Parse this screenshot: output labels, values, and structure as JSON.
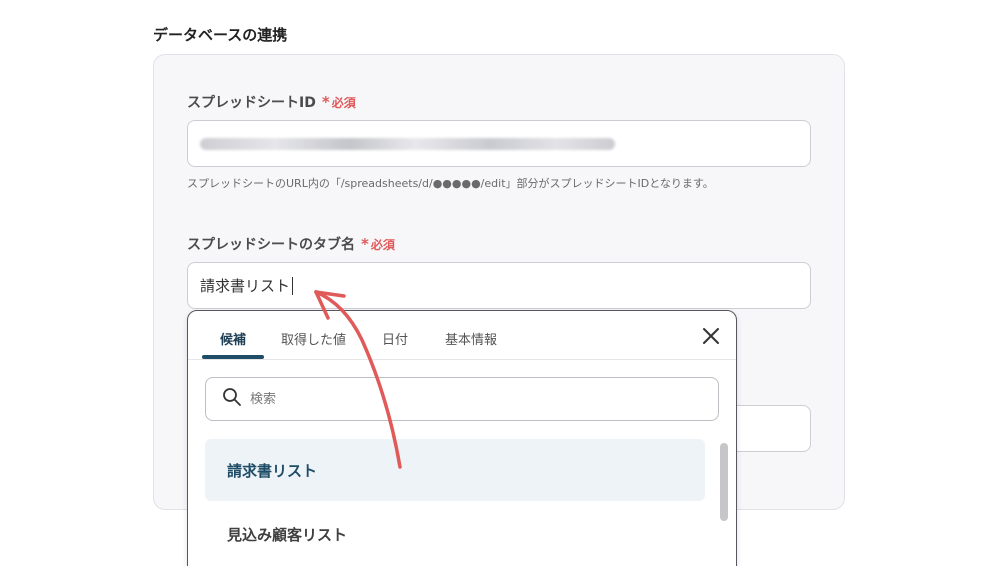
{
  "section": {
    "title": "データベースの連携"
  },
  "fields": {
    "spreadsheet_id": {
      "label": "スプレッドシートID",
      "required": "必須",
      "help": "スプレッドシートのURL内の「/spreadsheets/d/●●●●●/edit」部分がスプレッドシートIDとなります。"
    },
    "tab_name": {
      "label": "スプレッドシートのタブ名",
      "required": "必須",
      "value": "請求書リスト"
    }
  },
  "dropdown": {
    "tabs": [
      {
        "label": "候補",
        "active": true
      },
      {
        "label": "取得した値",
        "active": false
      },
      {
        "label": "日付",
        "active": false
      },
      {
        "label": "基本情報",
        "active": false
      }
    ],
    "search_placeholder": "検索",
    "options": [
      {
        "label": "請求書リスト",
        "selected": true
      },
      {
        "label": "見込み顧客リスト",
        "selected": false
      }
    ]
  },
  "colors": {
    "accent": "#1f4d66",
    "required": "#e05a5a",
    "annotation_arrow": "#e05a5a"
  },
  "icons": {
    "search": "search-icon",
    "close": "close-icon"
  }
}
